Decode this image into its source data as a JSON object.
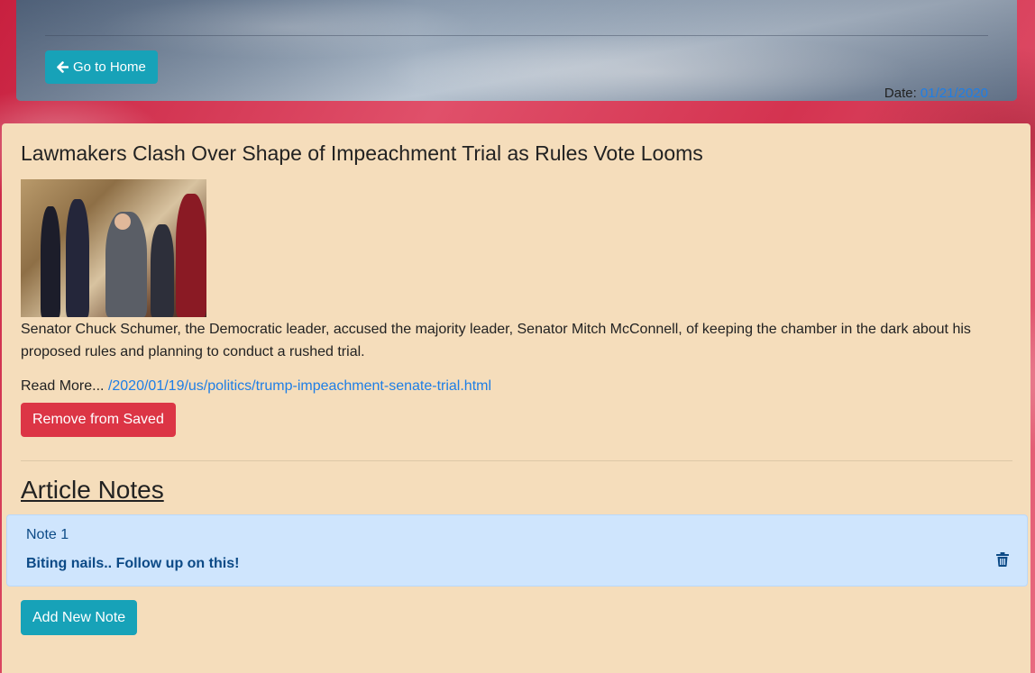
{
  "header": {
    "home_button_label": "Go to Home",
    "home_icon": "arrow-left-icon",
    "date_label": "Date:",
    "date_value": "01/21/2020"
  },
  "article": {
    "title": "Lawmakers Clash Over Shape of Impeachment Trial as Rules Vote Looms",
    "summary": "Senator Chuck Schumer, the Democratic leader, accused the majority leader, Senator Mitch McConnell, of keeping the chamber in the dark about his proposed rules and planning to conduct a rushed trial.",
    "read_more_label": "Read More...",
    "link": "/2020/01/19/us/politics/trump-impeachment-senate-trial.html",
    "remove_button_label": "Remove from Saved"
  },
  "notes": {
    "heading": "Article Notes",
    "items": [
      {
        "title": "Note 1",
        "body": "Biting nails.. Follow up on this!",
        "delete_icon": "trash-icon"
      }
    ],
    "add_button_label": "Add New Note"
  },
  "colors": {
    "info": "#17a2b8",
    "danger": "#dc3545",
    "link": "#1e7ee6",
    "card_background": "#f5ddbb",
    "note_background": "#cfe5fd"
  }
}
